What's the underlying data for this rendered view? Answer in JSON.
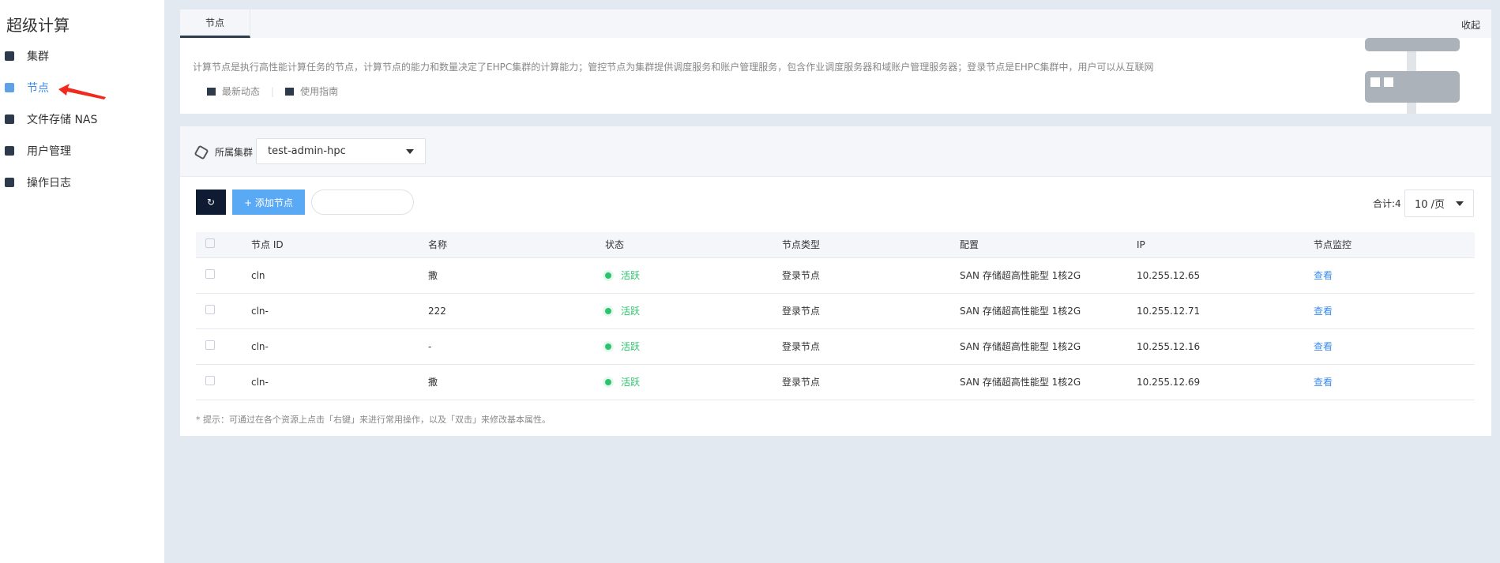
{
  "sidebar": {
    "title": "超级计算",
    "items": [
      {
        "label": "集群"
      },
      {
        "label": "节点"
      },
      {
        "label": "文件存储 NAS"
      },
      {
        "label": "用户管理"
      },
      {
        "label": "操作日志"
      }
    ]
  },
  "intro": {
    "tab": "节点",
    "collapse": "收起",
    "description": "计算节点是执行高性能计算任务的节点，计算节点的能力和数量决定了EHPC集群的计算能力；管控节点为集群提供调度服务和账户管理服务，包含作业调度服务器和域账户管理服务器；登录节点是EHPC集群中，用户可以从互联网",
    "links": [
      "最新动态",
      "使用指南"
    ]
  },
  "filter": {
    "label": "所属集群",
    "cluster": "test-admin-hpc"
  },
  "toolbar": {
    "add_label": "+ 添加节点",
    "search_placeholder": "",
    "total": "合计:4",
    "page_size": "10 /页"
  },
  "table": {
    "headers": [
      "节点 ID",
      "名称",
      "状态",
      "节点类型",
      "配置",
      "IP",
      "节点监控"
    ],
    "rows": [
      {
        "id": "cln",
        "name": "撒",
        "status": "活跃",
        "type": "登录节点",
        "config": "SAN 存储超高性能型 1核2G",
        "ip": "10.255.12.65",
        "monitor": "查看"
      },
      {
        "id": "cln-",
        "name": "222",
        "status": "活跃",
        "type": "登录节点",
        "config": "SAN 存储超高性能型 1核2G",
        "ip": "10.255.12.71",
        "monitor": "查看"
      },
      {
        "id": "cln-",
        "name": "-",
        "status": "活跃",
        "type": "登录节点",
        "config": "SAN 存储超高性能型 1核2G",
        "ip": "10.255.12.16",
        "monitor": "查看"
      },
      {
        "id": "cln-",
        "name": "撒",
        "status": "活跃",
        "type": "登录节点",
        "config": "SAN 存储超高性能型 1核2G",
        "ip": "10.255.12.69",
        "monitor": "查看"
      }
    ]
  },
  "hint": "* 提示：可通过在各个资源上点击「右键」来进行常用操作，以及「双击」来修改基本属性。"
}
